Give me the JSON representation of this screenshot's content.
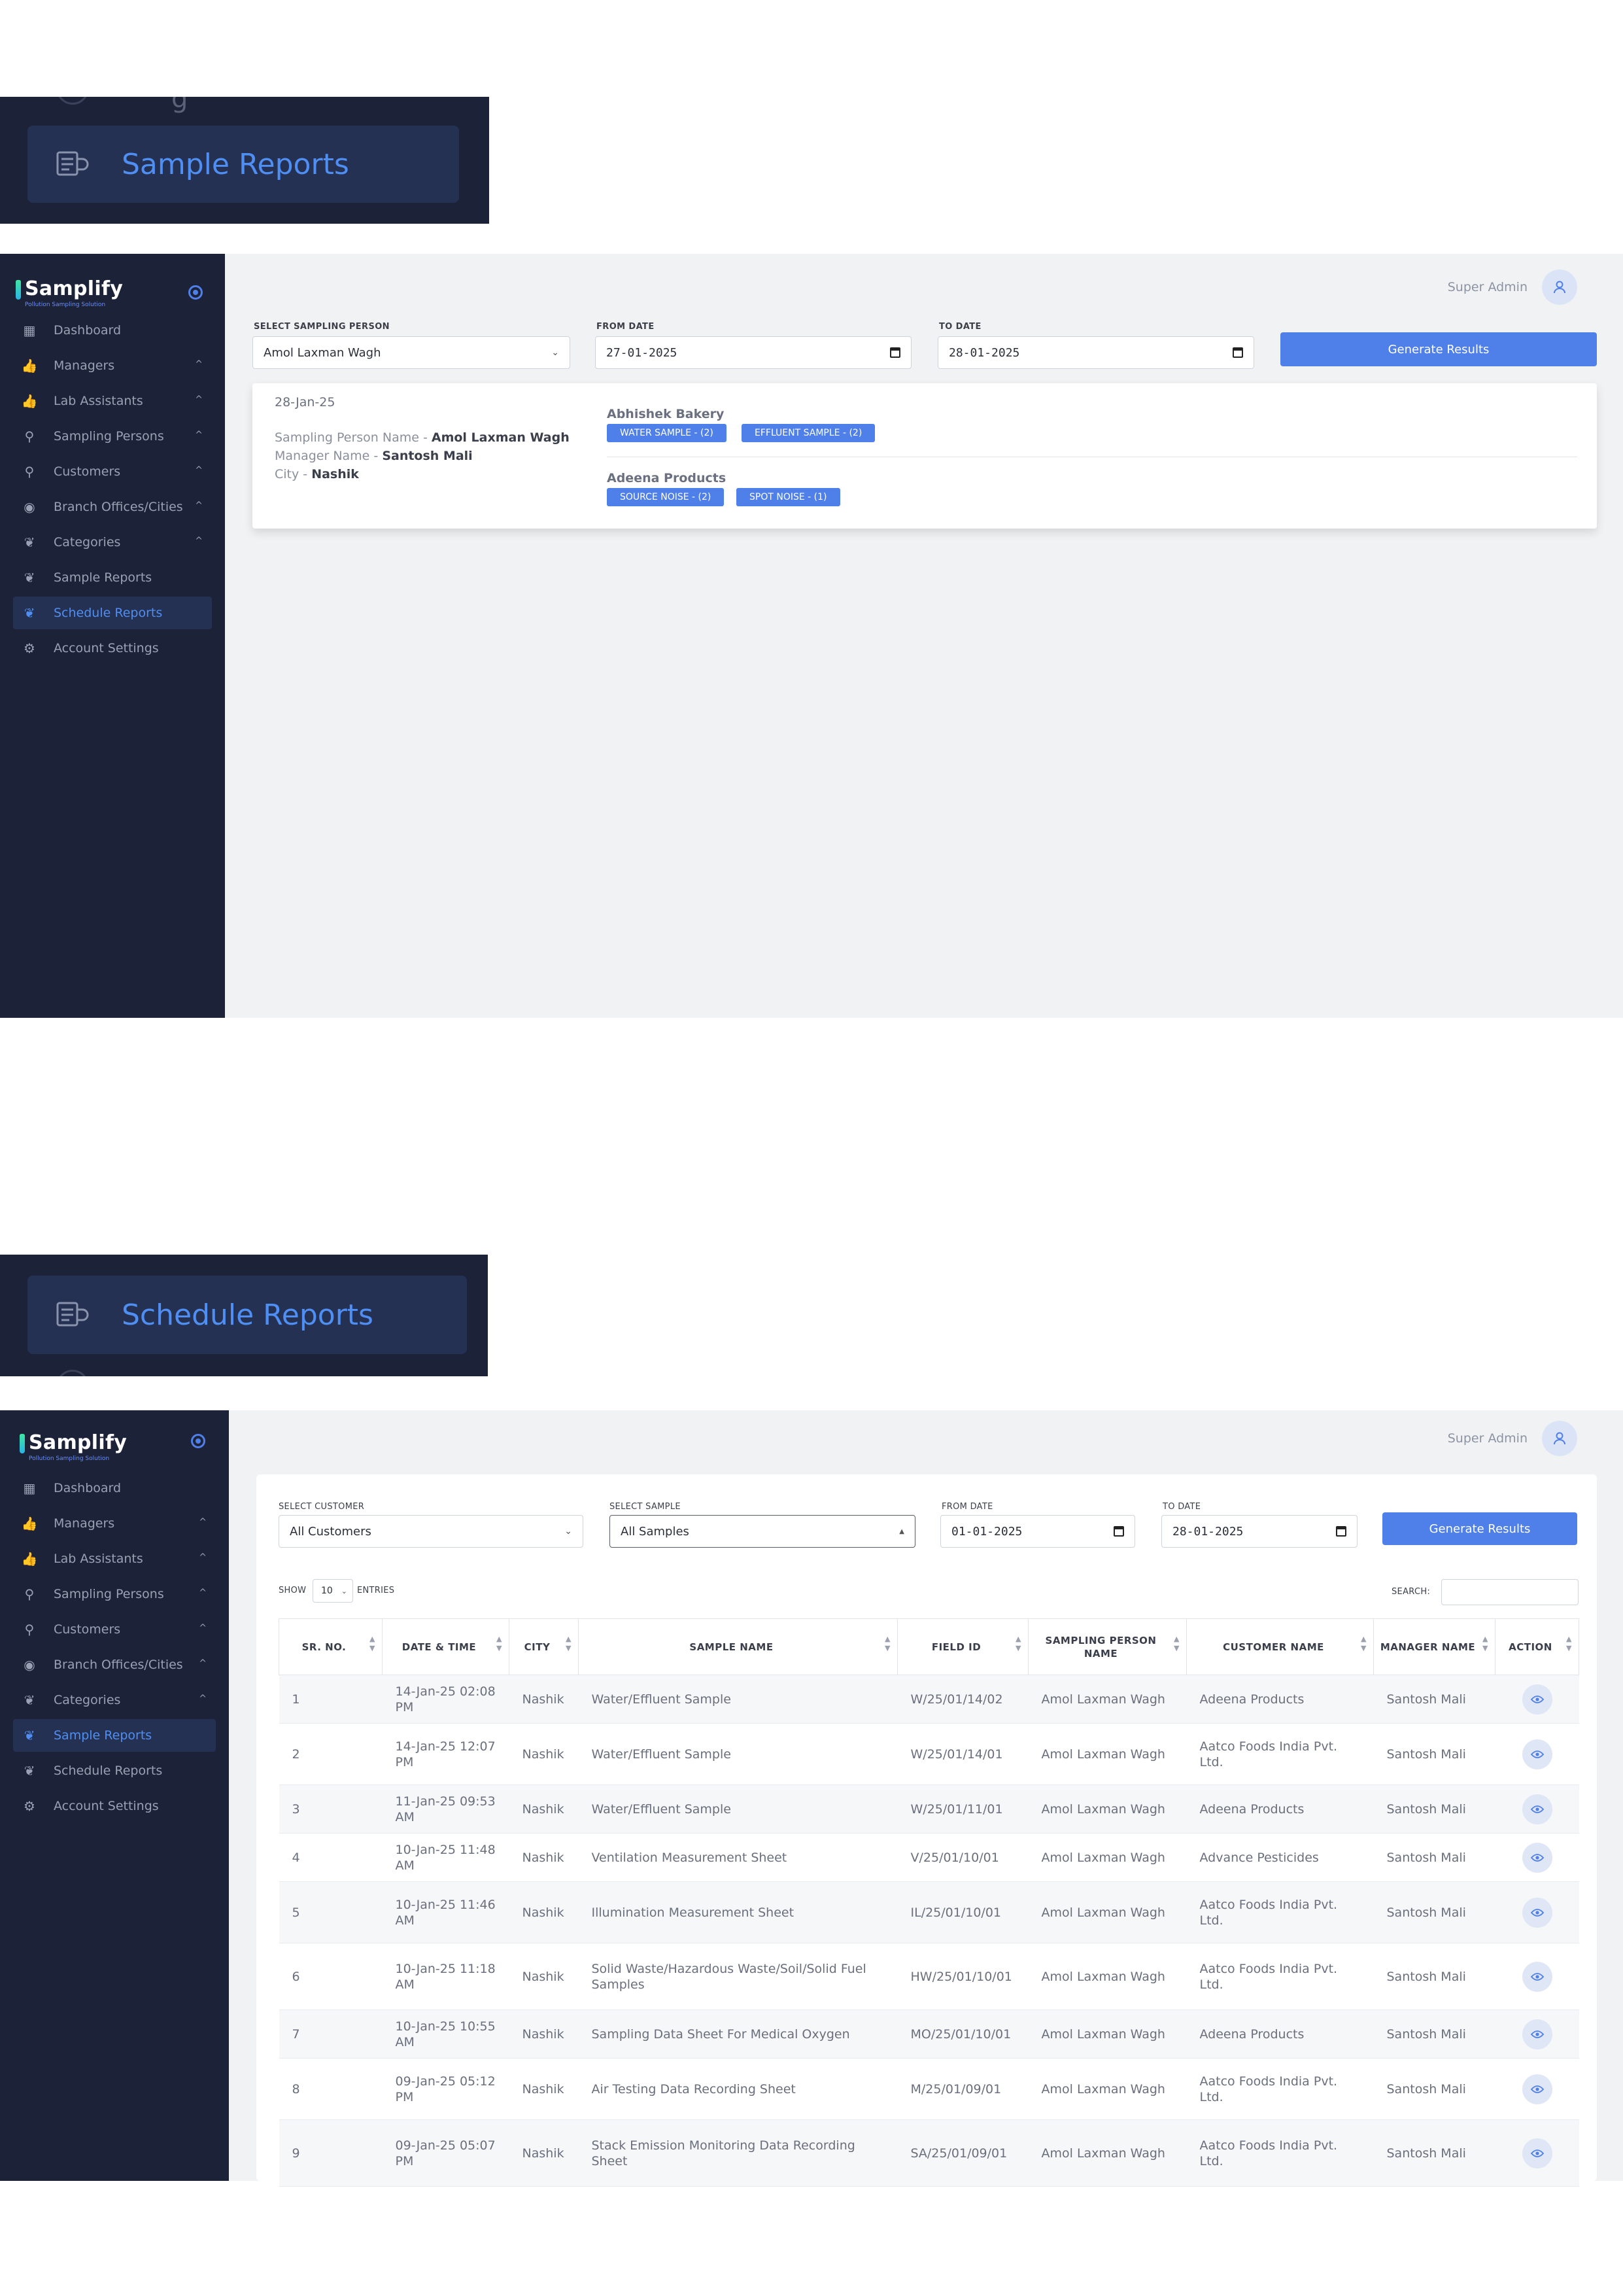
{
  "banner_sample": {
    "label": "Sample Reports",
    "ghost_text": "g"
  },
  "banner_schedule": {
    "label": "Schedule Reports"
  },
  "brand": {
    "name": "Samplify",
    "tagline": "Pollution Sampling Solution"
  },
  "user": {
    "name": "Super Admin"
  },
  "sidebar_top": [
    {
      "label": "Dashboard",
      "icon": "dashboard-icon",
      "caret": ""
    },
    {
      "label": "Managers",
      "icon": "thumbs-up-icon",
      "caret": "^"
    },
    {
      "label": "Lab Assistants",
      "icon": "thumbs-up-icon",
      "caret": "^"
    },
    {
      "label": "Sampling Persons",
      "icon": "user-tag-icon",
      "caret": "^"
    },
    {
      "label": "Customers",
      "icon": "user-tag-icon",
      "caret": "^"
    },
    {
      "label": "Branch Offices/Cities",
      "icon": "map-pin-icon",
      "caret": "^"
    },
    {
      "label": "Categories",
      "icon": "leaf-icon",
      "caret": "^"
    },
    {
      "label": "Sample Reports",
      "icon": "leaf-icon",
      "caret": ""
    },
    {
      "label": "Schedule Reports",
      "icon": "leaf-icon",
      "caret": ""
    },
    {
      "label": "Account Settings",
      "icon": "gear-icon",
      "caret": ""
    }
  ],
  "sidebar_bottom": [
    {
      "label": "Dashboard",
      "icon": "dashboard-icon",
      "caret": ""
    },
    {
      "label": "Managers",
      "icon": "thumbs-up-icon",
      "caret": "^"
    },
    {
      "label": "Lab Assistants",
      "icon": "thumbs-up-icon",
      "caret": "^"
    },
    {
      "label": "Sampling Persons",
      "icon": "user-tag-icon",
      "caret": "^"
    },
    {
      "label": "Customers",
      "icon": "user-tag-icon",
      "caret": "^"
    },
    {
      "label": "Branch Offices/Cities",
      "icon": "map-pin-icon",
      "caret": "^"
    },
    {
      "label": "Categories",
      "icon": "leaf-icon",
      "caret": "^"
    },
    {
      "label": "Sample Reports",
      "icon": "leaf-icon",
      "caret": ""
    },
    {
      "label": "Schedule Reports",
      "icon": "leaf-icon",
      "caret": ""
    },
    {
      "label": "Account Settings",
      "icon": "gear-icon",
      "caret": ""
    }
  ],
  "schedule_filters": {
    "person_label": "SELECT SAMPLING PERSON",
    "person_value": "Amol Laxman Wagh",
    "from_label": "FROM DATE",
    "from_value": "27-01-2025",
    "to_label": "TO DATE",
    "to_value": "28-01-2025",
    "button": "Generate Results"
  },
  "schedule_result": {
    "date": "28-Jan-25",
    "person_prefix": "Sampling Person Name - ",
    "person": "Amol Laxman Wagh",
    "manager_prefix": "Manager Name - ",
    "manager": "Santosh Mali",
    "city_prefix": "City - ",
    "city": "Nashik",
    "companies": [
      {
        "name": "Abhishek Bakery",
        "tags": [
          "WATER SAMPLE - (2)",
          "EFFLUENT SAMPLE - (2)"
        ]
      },
      {
        "name": "Adeena Products",
        "tags": [
          "SOURCE NOISE - (2)",
          "SPOT NOISE - (1)"
        ]
      }
    ]
  },
  "sample_filters": {
    "customer_label": "SELECT CUSTOMER",
    "customer_value": "All Customers",
    "sample_label": "SELECT SAMPLE",
    "sample_value": "All Samples",
    "from_label": "FROM DATE",
    "from_value": "01-01-2025",
    "to_label": "TO DATE",
    "to_value": "28-01-2025",
    "button": "Generate Results",
    "show_label": "SHOW",
    "entries_value": "10",
    "entries_label": "ENTRIES",
    "search_label": "SEARCH:"
  },
  "table": {
    "headers": [
      "SR. NO.",
      "DATE & TIME",
      "CITY",
      "SAMPLE NAME",
      "FIELD ID",
      "SAMPLING PERSON NAME",
      "CUSTOMER NAME",
      "MANAGER NAME",
      "ACTION"
    ],
    "rows": [
      [
        "1",
        "14-Jan-25 02:08 PM",
        "Nashik",
        "Water/Effluent Sample",
        "W/25/01/14/02",
        "Amol Laxman Wagh",
        "Adeena Products",
        "Santosh Mali"
      ],
      [
        "2",
        "14-Jan-25 12:07 PM",
        "Nashik",
        "Water/Effluent Sample",
        "W/25/01/14/01",
        "Amol Laxman Wagh",
        "Aatco Foods India Pvt. Ltd.",
        "Santosh Mali"
      ],
      [
        "3",
        "11-Jan-25 09:53 AM",
        "Nashik",
        "Water/Effluent Sample",
        "W/25/01/11/01",
        "Amol Laxman Wagh",
        "Adeena Products",
        "Santosh Mali"
      ],
      [
        "4",
        "10-Jan-25 11:48 AM",
        "Nashik",
        "Ventilation Measurement Sheet",
        "V/25/01/10/01",
        "Amol Laxman Wagh",
        "Advance Pesticides",
        "Santosh Mali"
      ],
      [
        "5",
        "10-Jan-25 11:46 AM",
        "Nashik",
        "Illumination Measurement Sheet",
        "IL/25/01/10/01",
        "Amol Laxman Wagh",
        "Aatco Foods India Pvt. Ltd.",
        "Santosh Mali"
      ],
      [
        "6",
        "10-Jan-25 11:18 AM",
        "Nashik",
        "Solid Waste/Hazardous Waste/Soil/Solid Fuel Samples",
        "HW/25/01/10/01",
        "Amol Laxman Wagh",
        "Aatco Foods India Pvt. Ltd.",
        "Santosh Mali"
      ],
      [
        "7",
        "10-Jan-25 10:55 AM",
        "Nashik",
        "Sampling Data Sheet For Medical Oxygen",
        "MO/25/01/10/01",
        "Amol Laxman Wagh",
        "Adeena Products",
        "Santosh Mali"
      ],
      [
        "8",
        "09-Jan-25 05:12 PM",
        "Nashik",
        "Air Testing Data Recording Sheet",
        "M/25/01/09/01",
        "Amol Laxman Wagh",
        "Aatco Foods India Pvt. Ltd.",
        "Santosh Mali"
      ],
      [
        "9",
        "09-Jan-25 05:07 PM",
        "Nashik",
        "Stack Emission Monitoring Data Recording Sheet",
        "SA/25/01/09/01",
        "Amol Laxman Wagh",
        "Aatco Foods India Pvt. Ltd.",
        "Santosh Mali"
      ]
    ]
  },
  "colors": {
    "sidebar": "#1c2238",
    "accent": "#4f7fe8",
    "active_bg": "#253152",
    "active_text": "#4f8ef2"
  }
}
